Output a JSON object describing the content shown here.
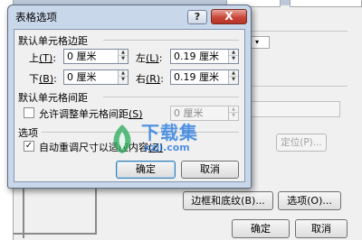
{
  "dialog": {
    "title": "表格选项",
    "help_glyph": "?",
    "close_glyph": "X",
    "margins": {
      "section_label": "默认单元格边距",
      "top": {
        "label_main": "上",
        "label_key": "(T)",
        "value": "0 厘米"
      },
      "left": {
        "label_main": "左",
        "label_key": "(L)",
        "value": "0.19 厘米"
      },
      "bottom": {
        "label_main": "下",
        "label_key": "(B)",
        "value": "0 厘米"
      },
      "right": {
        "label_main": "右",
        "label_key": "(R)",
        "value": "0.19 厘米"
      }
    },
    "spacing": {
      "section_label": "默认单元格间距",
      "checkbox_label": "允许调整单元格间距",
      "checkbox_key": "(S)",
      "checked": false,
      "value": "0 厘米"
    },
    "options": {
      "section_label": "选项",
      "checkbox_label_visible": "自动重调尺寸以适应内容",
      "checkbox_key": "(Z)",
      "checked": true
    },
    "ok_label": "确定",
    "cancel_label": "取消"
  },
  "background": {
    "small_combo_text": "▾",
    "position_button_label": "定位(P)...",
    "borders_button_label": "边框和底纹(B)...",
    "options_button_label": "选项(O)...",
    "ok_label": "确定",
    "cancel_label": "取消"
  },
  "watermark": {
    "text": "下载集",
    "domain": "xzji.com"
  },
  "colors": {
    "dialog_frame": "#c9d7ea",
    "close_button": "#c9473a",
    "watermark": "#146edc"
  }
}
